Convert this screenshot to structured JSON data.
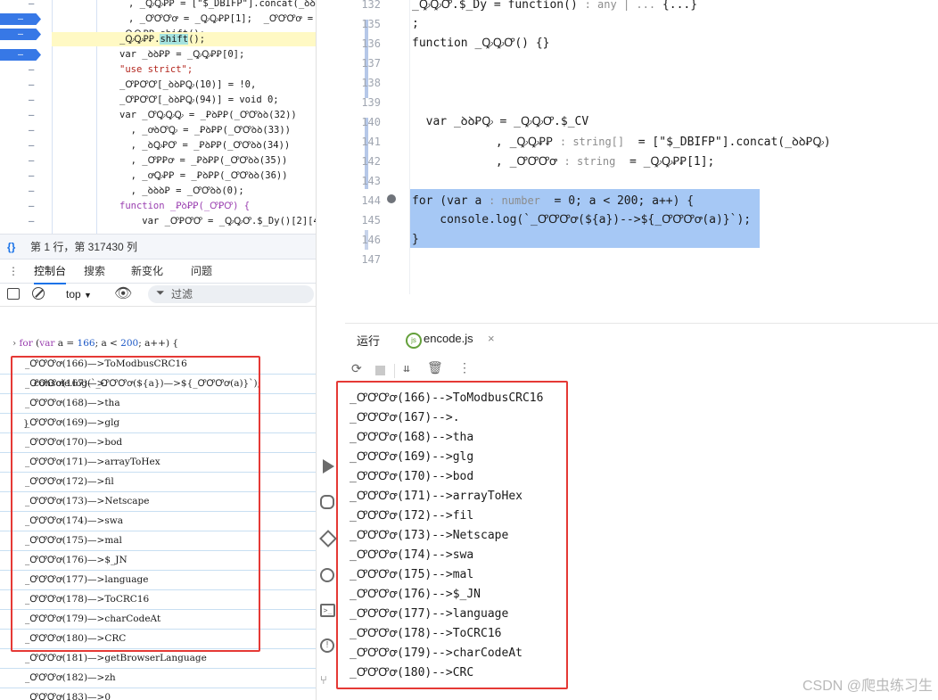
{
  "devtools": {
    "source_lines": [
      {
        "marker": "",
        "text": ", _ꝘꝘꝐꝐ = [\"$_DBIFP\"].concat(_ꝺꝺ"
      },
      {
        "marker": "",
        "text": ", _ꝌꝌꝌꝍ = _ꝘꝘꝐꝐ[1];  _ꝌꝌꝌꝍ = _"
      },
      {
        "marker": "-",
        "text": "_ꝘꝘꝐꝐ.shift();"
      },
      {
        "marker": "-",
        "text": "var _ꝺꝺꝐꝐ = _ꝘꝘꝐꝐ[0];"
      },
      {
        "marker": "",
        "text": "\"use strict\";"
      },
      {
        "marker": "",
        "text": "_ꝌꝐꝌꝌ[_ꝺꝺꝐꝘ(10)] = !0,"
      },
      {
        "marker": "",
        "text": "_ꝌꝐꝌꝌ[_ꝺꝺꝐꝘ(94)] = void 0;"
      },
      {
        "marker": "",
        "text": "var _ꝌꝘꝘꝘ = _ꝐꝺꝐꝐ(_ꝌꝌꝺꝺ(32))"
      },
      {
        "marker": "",
        "text": "  , _ꝍꝺꝌꝘ = _ꝐꝺꝐꝐ(_ꝌꝌꝺꝺ(33))"
      },
      {
        "marker": "",
        "text": "  , _ꝺꝘꝐꝌ = _ꝐꝺꝐꝐ(_ꝌꝌꝺꝺ(34))"
      },
      {
        "marker": "",
        "text": "  , _ꝌꝐꝐꝍ = _ꝐꝺꝐꝐ(_ꝌꝌꝺꝺ(35))"
      },
      {
        "marker": "",
        "text": "  , _ꝍꝘꝐꝐ = _ꝐꝺꝐꝐ(_ꝌꝌꝺꝺ(36))"
      },
      {
        "marker": "",
        "text": "  , _ꝺꝺꝺꝐ = _ꝌꝌꝺꝺ(0);"
      },
      {
        "marker": "",
        "text": "function _ꝐꝺꝐꝐ(_ꝌꝐꝌ) {"
      },
      {
        "marker": "",
        "text": "    var _ꝌꝐꝌꝌ = _ꝘꝘꝌ.$_Dy()[2][4"
      },
      {
        "marker": "",
        "text": "    f    (_ꝌꝐꝌꝌ  _  ꝘꝘꝘ  ꝌꝐ ("
      }
    ],
    "status": {
      "icon": "braces-icon",
      "text": "第 1 行，第 317430 列"
    },
    "tabs": [
      "控制台",
      "搜索",
      "新变化",
      "问题"
    ],
    "active_tab": "控制台",
    "toolbar": {
      "context": "top",
      "filter_placeholder": "过滤"
    },
    "console_input": [
      "> for (var a = 166; a < 200; a++) {",
      "      console.log(`_ꝌꝌꝌꝍ(${a})—>${_ꝌꝌꝌꝍ(a)}`);",
      "  }"
    ],
    "console_output": [
      "_ꝌꝌꝌꝍ(166)—>ToModbusCRC16",
      "_ꝌꝌꝌꝍ(167)—>.",
      "_ꝌꝌꝌꝍ(168)—>tha",
      "_ꝌꝌꝌꝍ(169)—>glg",
      "_ꝌꝌꝌꝍ(170)—>bod",
      "_ꝌꝌꝌꝍ(171)—>arrayToHex",
      "_ꝌꝌꝌꝍ(172)—>fil",
      "_ꝌꝌꝌꝍ(173)—>Netscape",
      "_ꝌꝌꝌꝍ(174)—>swa",
      "_ꝌꝌꝌꝍ(175)—>mal",
      "_ꝌꝌꝌꝍ(176)—>$_JN",
      "_ꝌꝌꝌꝍ(177)—>language",
      "_ꝌꝌꝌꝍ(178)—>ToCRC16",
      "_ꝌꝌꝌꝍ(179)—>charCodeAt",
      "_ꝌꝌꝌꝍ(180)—>CRC",
      "_ꝌꝌꝌꝍ(181)—>getBrowserLanguage",
      "_ꝌꝌꝌꝍ(182)—>zh",
      "_ꝌꝌꝌꝍ(183)—>0"
    ]
  },
  "editor": {
    "lines": [
      {
        "n": "132",
        "code": "_ꝘꝘꝌ.$_Dy = function() ",
        "hint": ": any | ...",
        "tail": " {...}"
      },
      {
        "n": "135",
        "code": ";"
      },
      {
        "n": "136",
        "code": "function _ꝘꝘꝌ() {}"
      },
      {
        "n": "137",
        "code": ""
      },
      {
        "n": "138",
        "code": ""
      },
      {
        "n": "139",
        "code": ""
      },
      {
        "n": "140",
        "code": "  var _ꝺꝺꝐꝘ = _ꝘꝘꝌ.$_CV"
      },
      {
        "n": "141",
        "code": "            , _ꝘꝘꝐꝐ ",
        "hint": ": string[]",
        "tail": "  = [\"$_DBIFP\"].concat(_ꝺꝺꝐꝘ)"
      },
      {
        "n": "142",
        "code": "            , _ꝌꝌꝌꝍ ",
        "hint": ": string",
        "tail": "  = _ꝘꝘꝐꝐ[1];"
      },
      {
        "n": "143",
        "code": ""
      },
      {
        "n": "144",
        "code": "for (var a ",
        "hint": ": number",
        "tail": "  = 0; a < 200; a++) {"
      },
      {
        "n": "145",
        "code": "    console.log(`_ꝌꝌꝌꝍ(${a})-->${_ꝌꝌꝌꝍ(a)}`);"
      },
      {
        "n": "146",
        "code": "}"
      },
      {
        "n": "147",
        "code": ""
      }
    ]
  },
  "run_panel": {
    "tab_label": "运行",
    "file_tab": "encode.js",
    "output": [
      "_ꝌꝌꝌꝍ(166)-->ToModbusCRC16",
      "_ꝌꝌꝌꝍ(167)-->.",
      "_ꝌꝌꝌꝍ(168)-->tha",
      "_ꝌꝌꝌꝍ(169)-->glg",
      "_ꝌꝌꝌꝍ(170)-->bod",
      "_ꝌꝌꝌꝍ(171)-->arrayToHex",
      "_ꝌꝌꝌꝍ(172)-->fil",
      "_ꝌꝌꝌꝍ(173)-->Netscape",
      "_ꝌꝌꝌꝍ(174)-->swa",
      "_ꝌꝌꝌꝍ(175)-->mal",
      "_ꝌꝌꝌꝍ(176)-->$_JN",
      "_ꝌꝌꝌꝍ(177)-->language",
      "_ꝌꝌꝌꝍ(178)-->ToCRC16",
      "_ꝌꝌꝌꝍ(179)-->charCodeAt",
      "_ꝌꝌꝌꝍ(180)-->CRC"
    ]
  },
  "watermark": "CSDN @爬虫练习生",
  "colors": {
    "highlight_red": "#e53935",
    "selection_blue": "#a6c8f5",
    "accent_blue": "#1a73e8"
  }
}
